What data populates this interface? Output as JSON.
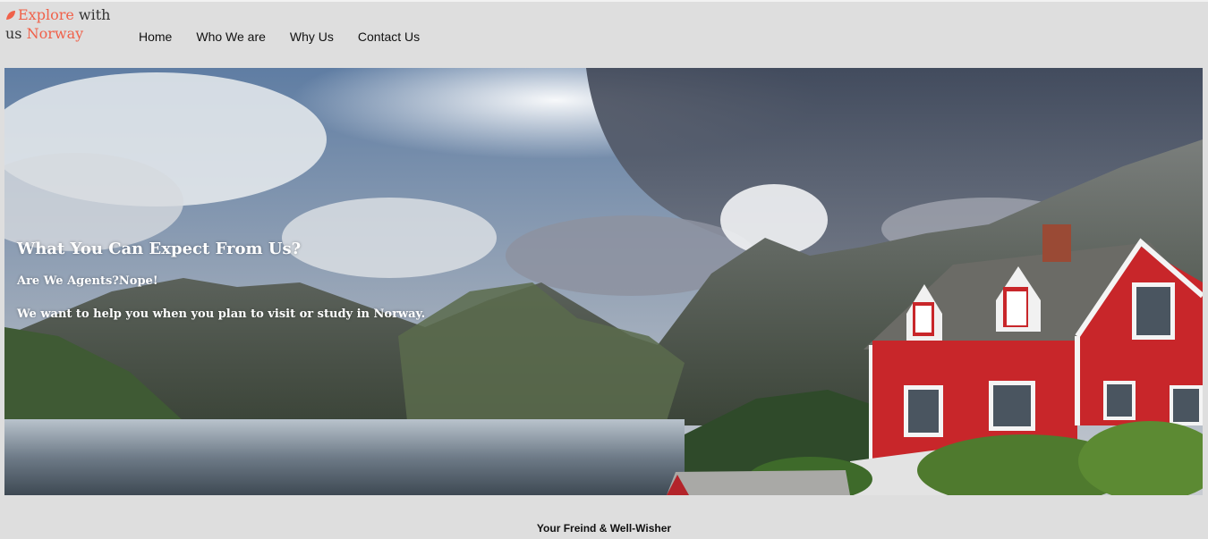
{
  "logo": {
    "word1": "Explore",
    "word2": " with",
    "word3": "us ",
    "word4": "Norway",
    "icon": "leaf-icon",
    "accent_color": "#f0614a"
  },
  "nav": {
    "items": [
      "Home",
      "Who We are",
      "Why Us",
      "Contact Us"
    ]
  },
  "hero": {
    "title": "What You Can Expect From Us?",
    "subtitle": "Are We Agents?Nope!",
    "body": "We want to help you when you plan to visit or study in Norway."
  },
  "footer": {
    "text": "Your Freind & Well-Wisher"
  }
}
